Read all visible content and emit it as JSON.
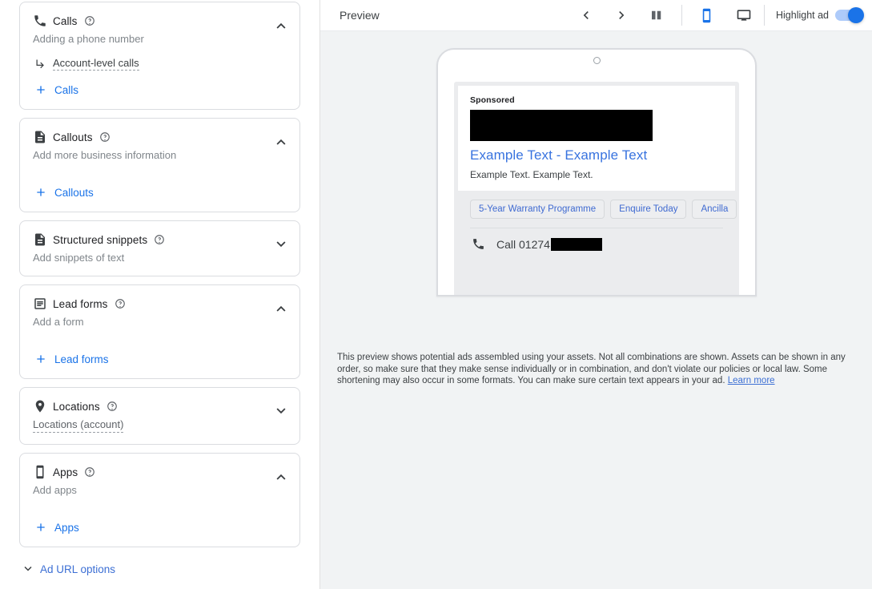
{
  "left_panel": {
    "cards": [
      {
        "id": "calls",
        "icon": "phone-icon",
        "title": "Calls",
        "subtitle": "Adding a phone number",
        "subtitle_dashed": false,
        "expanded": true,
        "chevron": "chevron-up-icon",
        "account_link": "Account-level calls",
        "add_label": "Calls"
      },
      {
        "id": "callouts",
        "icon": "description-icon",
        "title": "Callouts",
        "subtitle": "Add more business information",
        "subtitle_dashed": false,
        "expanded": true,
        "chevron": "chevron-up-icon",
        "add_label": "Callouts"
      },
      {
        "id": "structured-snippets",
        "icon": "description-icon",
        "title": "Structured snippets",
        "subtitle": "Add snippets of text",
        "subtitle_dashed": false,
        "expanded": false,
        "chevron": "chevron-down-icon"
      },
      {
        "id": "lead-forms",
        "icon": "list-alt-icon",
        "title": "Lead forms",
        "subtitle": "Add a form",
        "subtitle_dashed": false,
        "expanded": true,
        "chevron": "chevron-up-icon",
        "add_label": "Lead forms"
      },
      {
        "id": "locations",
        "icon": "location-pin-icon",
        "title": "Locations",
        "subtitle": "Locations (account)",
        "subtitle_dashed": true,
        "expanded": false,
        "chevron": "chevron-down-icon"
      },
      {
        "id": "apps",
        "icon": "mobile-phone-icon",
        "title": "Apps",
        "subtitle": "Add apps",
        "subtitle_dashed": false,
        "expanded": true,
        "chevron": "chevron-up-icon",
        "add_label": "Apps"
      }
    ],
    "ad_url_options": "Ad URL options",
    "help_icon": "help-circle-icon",
    "add_icon": "plus-icon",
    "sub_arrow_icon": "subdirectory-arrow-icon"
  },
  "preview": {
    "title": "Preview",
    "prev_icon": "chevron-left-icon",
    "next_icon": "chevron-right-icon",
    "compare_icon": "split-view-icon",
    "mobile_icon": "mobile-device-icon",
    "desktop_icon": "desktop-device-icon",
    "mobile_selected": true,
    "highlight_ad_label": "Highlight ad",
    "highlight_ad_on": true,
    "accent_color": "#1a73e8",
    "toggle_track_color": "#aecbfa"
  },
  "ad": {
    "sponsored_label": "Sponsored",
    "image_redacted": true,
    "headline": "Example Text - Example Text",
    "description": "Example Text. Example Text.",
    "sitelinks": [
      "5-Year Warranty Programme",
      "Enquire Today",
      "Ancilla"
    ],
    "call_icon": "phone-icon",
    "call_label": "Call 01274",
    "call_redacted": true,
    "headline_color": "#3873df"
  },
  "disclaimer": {
    "text": "This preview shows potential ads assembled using your assets. Not all combinations are shown. Assets can be shown in any order, so make sure that they make sense individually or in combination, and don't violate our policies or local law. Some shortening may also occur in some formats. You can make sure certain text appears in your ad. ",
    "link_text": "Learn more"
  }
}
